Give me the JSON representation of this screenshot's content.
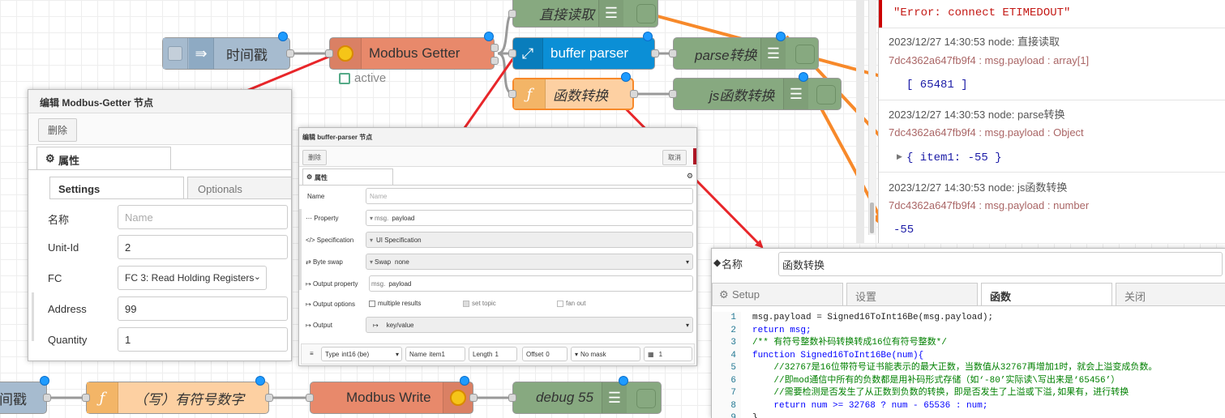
{
  "flow": {
    "timestamp_node": "时间戳",
    "modbus_getter": "Modbus Getter",
    "getter_status": "active",
    "direct_read": "直接读取",
    "buffer_parser": "buffer parser",
    "parse_convert": "parse转换",
    "func_convert": "函数转换",
    "js_func_convert": "js函数转换",
    "timestamp_node2": "间戳",
    "write_signed": "（写）有符号数字",
    "modbus_write": "Modbus Write",
    "debug55": "debug 55"
  },
  "getter_dialog": {
    "title": "编辑 Modbus-Getter 节点",
    "delete": "删除",
    "section": "属性",
    "tabs": [
      "Settings",
      "Optionals"
    ],
    "fields": {
      "name_label": "名称",
      "name_placeholder": "Name",
      "unitid_label": "Unit-Id",
      "unitid_value": "2",
      "fc_label": "FC",
      "fc_value": "FC 3: Read Holding Registers",
      "address_label": "Address",
      "address_value": "99",
      "quantity_label": "Quantity",
      "quantity_value": "1"
    }
  },
  "bp_dialog": {
    "title": "编辑 buffer-parser 节点",
    "delete": "删除",
    "cancel": "取消",
    "section": "属性",
    "name_label": "Name",
    "name_placeholder": "Name",
    "property_label": "Property",
    "property_prefix": "msg.",
    "property_value": "payload",
    "spec_label": "Specification",
    "spec_value": "UI Specification",
    "swap_label": "Byte swap",
    "swap_prefix": "Swap",
    "swap_value": "none",
    "outprop_label": "Output property",
    "outprop_prefix": "msg.",
    "outprop_value": "payload",
    "outopt_label": "Output options",
    "opt_multiple": "multiple results",
    "opt_settopic": "set topic",
    "opt_fanout": "fan out",
    "output_label": "Output",
    "output_value": "key/value",
    "row": {
      "type_label": "Type",
      "type_value": "int16 (be)",
      "name_label": "Name",
      "name_value": "item1",
      "length_label": "Length",
      "length_value": "1",
      "offset_label": "Offset",
      "offset_value": "0",
      "mask_value": "No mask",
      "scale_value": "1"
    }
  },
  "debug": {
    "error": "\"Error: connect ETIMEDOUT\"",
    "entries": [
      {
        "meta": "2023/12/27 14:30:53   node: 直接读取",
        "src": "7dc4362a647fb9f4 : msg.payload : array[1]",
        "value": "[ 65481 ]"
      },
      {
        "meta": "2023/12/27 14:30:53   node: parse转换",
        "src": "7dc4362a647fb9f4 : msg.payload : Object",
        "value": "{ item1: -55 }"
      },
      {
        "meta": "2023/12/27 14:30:53   node: js函数转换",
        "src": "7dc4362a647fb9f4 : msg.payload : number",
        "value": "-55"
      }
    ]
  },
  "func_dialog": {
    "name_label": "名称",
    "name_value": "函数转换",
    "tabs": [
      "Setup",
      "设置",
      "函数",
      "关闭"
    ],
    "code_lines": [
      {
        "n": "1",
        "t": "msg.payload = Signed16ToInt16Be(msg.payload);"
      },
      {
        "n": "2",
        "t": "return msg;"
      },
      {
        "n": "3",
        "t": "/** 有符号整数补码转换转成16位有符号整数*/"
      },
      {
        "n": "4",
        "t": "function Signed16ToInt16Be(num){"
      },
      {
        "n": "5",
        "t": "    //32767是16位带符号证书能表示的最大正数，当数值从32767再增加1时，就会上溢变成负数。"
      },
      {
        "n": "6",
        "t": "    //即mod通信中所有的负数都是用补码形式存储（如‘-80’实际读\\写出来是‘65456’）"
      },
      {
        "n": "7",
        "t": "    //需要检测是否发生了从正数到负数的转换，即是否发生了上溢或下溢,如果有，进行转换"
      },
      {
        "n": "8",
        "t": "    return num >= 32768 ? num - 65536 : num;"
      },
      {
        "n": "9",
        "t": "}"
      }
    ]
  },
  "colors": {
    "arrow_red": "#e8262a",
    "arrow_orange": "#f7892a",
    "node_blue": "#0b8fd6",
    "node_orange": "#e8896b",
    "node_green": "#87a980"
  }
}
